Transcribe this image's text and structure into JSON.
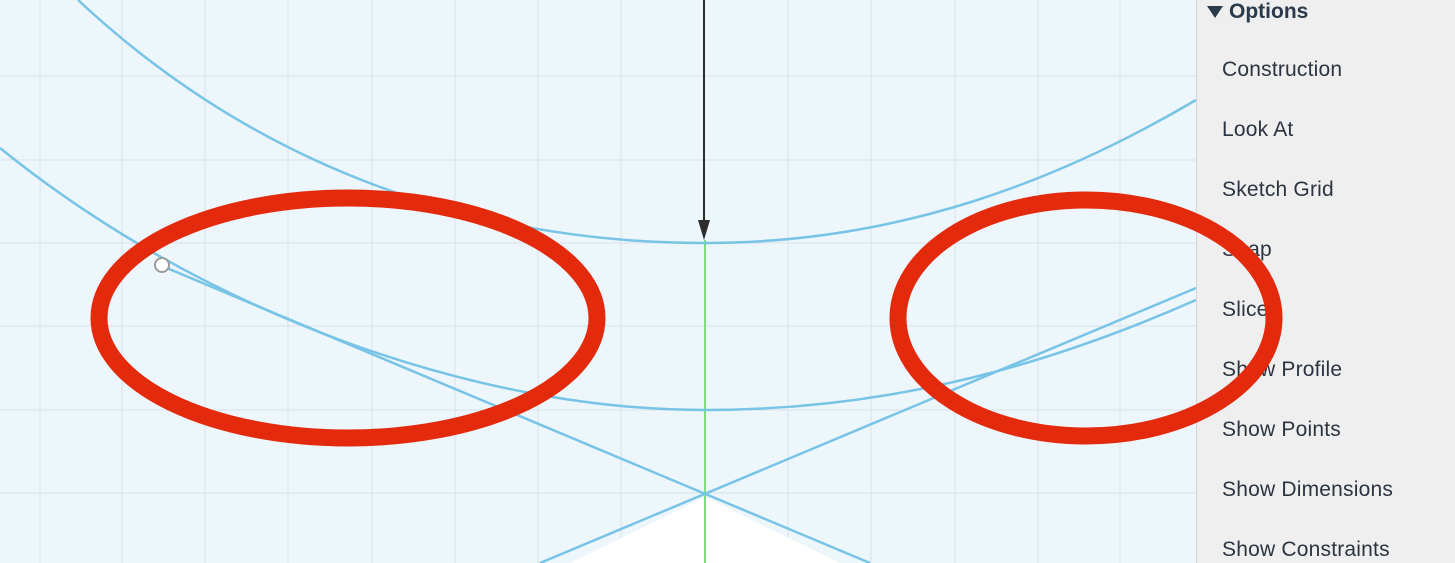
{
  "options_panel": {
    "header": "Options",
    "items": [
      {
        "label": "Construction"
      },
      {
        "label": "Look At"
      },
      {
        "label": "Sketch Grid"
      },
      {
        "label": "Snap"
      },
      {
        "label": "Slice"
      },
      {
        "label": "Show Profile"
      },
      {
        "label": "Show Points"
      },
      {
        "label": "Show Dimensions"
      },
      {
        "label": "Show Constraints"
      }
    ]
  },
  "colors": {
    "canvas_background": "#edf6fb",
    "grid_line": "#d7e2ea",
    "sketch_curve": "#78c4e6",
    "axis_green": "#7fdc7f",
    "annotation_red": "#e32a0c",
    "panel_background": "#efefef"
  }
}
